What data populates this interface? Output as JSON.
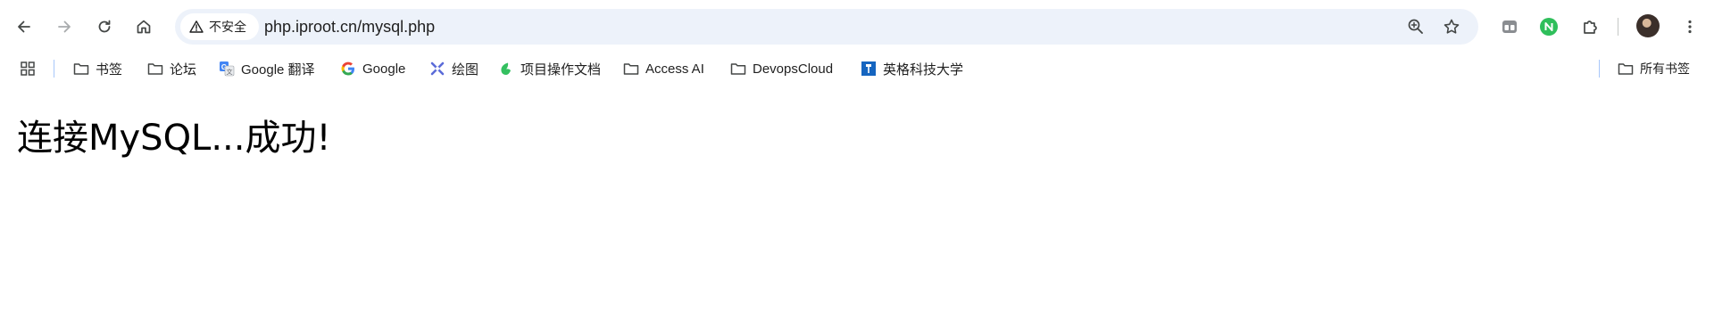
{
  "toolbar": {
    "security_label": "不安全",
    "url": "php.iproot.cn/mysql.php"
  },
  "bookmarks": [
    {
      "label": "",
      "icon": "apps-grid-icon"
    },
    {
      "label": "书签",
      "icon": "folder-icon"
    },
    {
      "label": "论坛",
      "icon": "folder-icon"
    },
    {
      "label": "Google 翻译",
      "icon": "google-translate-icon"
    },
    {
      "label": "Google",
      "icon": "google-g-icon"
    },
    {
      "label": "绘图",
      "icon": "draw-icon"
    },
    {
      "label": "项目操作文档",
      "icon": "leaf-icon"
    },
    {
      "label": "Access AI",
      "icon": "folder-icon"
    },
    {
      "label": "DevopsCloud",
      "icon": "folder-icon"
    },
    {
      "label": "英格科技大学",
      "icon": "university-icon"
    }
  ],
  "all_bookmarks_label": "所有书签",
  "page": {
    "heading": "连接MySQL...成功!"
  },
  "colors": {
    "omnibox_bg": "#edf2fa",
    "icon": "#444746",
    "disabled_icon": "#a8abad"
  }
}
